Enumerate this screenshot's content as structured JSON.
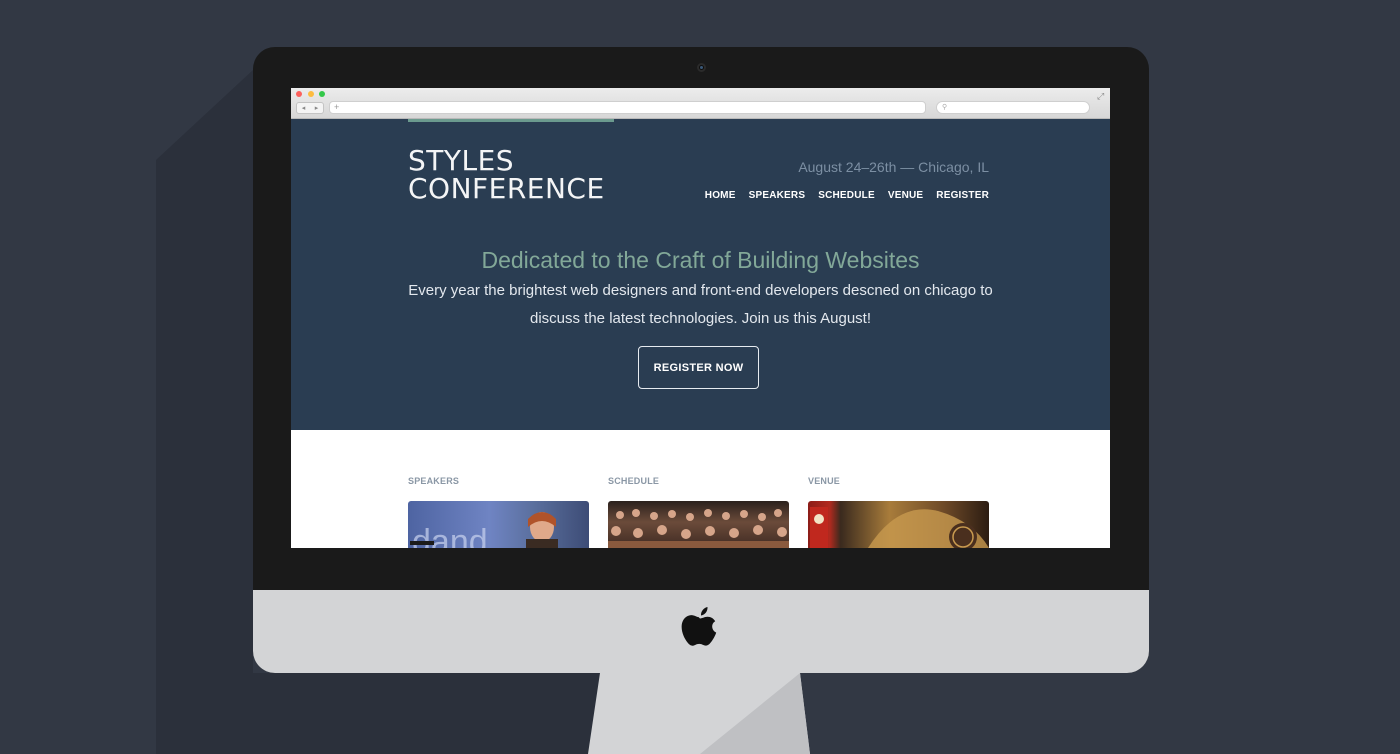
{
  "browser": {
    "address_text": "+",
    "back_glyph": "◂",
    "forward_glyph": "▸",
    "search_glyph": "⚲",
    "expand_glyph": "⤢"
  },
  "site": {
    "logo_line1": "STYLES",
    "logo_line2": "CONFERENCE",
    "event_info": "August 24–26th — Chicago, IL",
    "nav": [
      "HOME",
      "SPEAKERS",
      "SCHEDULE",
      "VENUE",
      "REGISTER"
    ],
    "tagline": "Dedicated to the Craft of Building Websites",
    "description": "Every year the brightest web designers and front-end developers descned on chicago to discuss the latest technologies. Join us this August!",
    "cta_label": "REGISTER NOW"
  },
  "teasers": [
    {
      "title": "SPEAKERS",
      "image_icon": "speaker-photo"
    },
    {
      "title": "SCHEDULE",
      "image_icon": "audience-photo"
    },
    {
      "title": "VENUE",
      "image_icon": "theater-photo"
    }
  ],
  "colors": {
    "background": "#323844",
    "hero": "#2a3d52",
    "accent": "#6b9a8e",
    "tagline": "#82a898"
  }
}
